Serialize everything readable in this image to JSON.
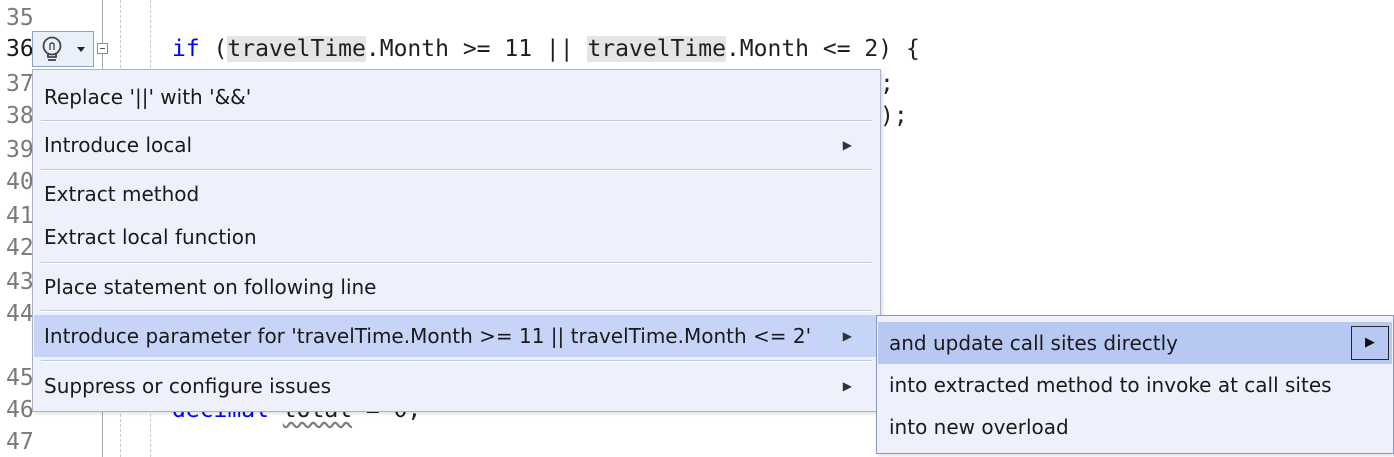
{
  "gutter": {
    "line_numbers": [
      "35",
      "36",
      "37",
      "38",
      "39",
      "40",
      "41",
      "42",
      "43",
      "44",
      "45",
      "46",
      "47"
    ],
    "active_line": "36"
  },
  "code": {
    "line36": {
      "kw_if": "if",
      "open": " (",
      "ident1": "travelTime",
      "mid1": ".Month >= 11 || ",
      "ident2": "travelTime",
      "mid2": ".Month <= 2) {"
    },
    "line37_tail": ";",
    "line38_tail": ");",
    "line46": {
      "kw": "decimal",
      "ident": "total",
      "rest": " = 0;"
    }
  },
  "quick_actions": {
    "icon": "lightbulb-icon",
    "dropdown_icon": "caret-down-icon"
  },
  "menu": {
    "items": [
      {
        "label": "Replace '||' with '&&'"
      },
      {
        "label": "Introduce local",
        "submenu_arrow": "▶"
      },
      {
        "label": "Extract method"
      },
      {
        "label": "Extract local function"
      },
      {
        "label": "Place statement on following line"
      },
      {
        "label": "Introduce parameter for 'travelTime.Month >= 11 || travelTime.Month <= 2'",
        "submenu_arrow": "▶",
        "selected": true
      },
      {
        "label": "Suppress or configure issues",
        "submenu_arrow": "▶"
      }
    ]
  },
  "submenu": {
    "items": [
      {
        "label": "and update call sites directly",
        "arrow": "▶",
        "selected": true
      },
      {
        "label": "into extracted method to invoke at call sites"
      },
      {
        "label": "into new overload"
      }
    ]
  },
  "colors": {
    "keyword": "#0000ff",
    "menu_bg": "#eef1fb",
    "selected_bg": "#c5d4f7"
  }
}
